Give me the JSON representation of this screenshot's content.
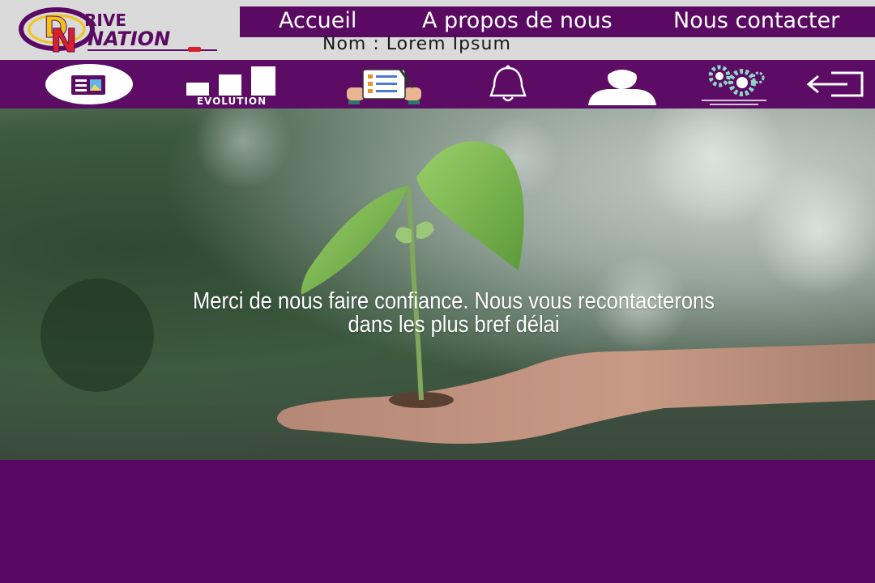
{
  "brand": {
    "logo_text_1": "RIVE",
    "logo_text_2": "NATION",
    "logo_letters": "DN"
  },
  "nav": {
    "items": [
      {
        "label": "Accueil"
      },
      {
        "label": "A propos de nous"
      },
      {
        "label": "Nous contacter"
      }
    ]
  },
  "user": {
    "name_line": "Nom : Lorem Ipsum"
  },
  "toolbar": {
    "items": [
      {
        "icon": "news-icon"
      },
      {
        "icon": "evolution-chart-icon",
        "label": "EVOLUTION"
      },
      {
        "icon": "form-checklist-icon"
      },
      {
        "icon": "bell-icon"
      },
      {
        "icon": "user-icon"
      },
      {
        "icon": "gears-icon"
      },
      {
        "icon": "logout-icon"
      }
    ]
  },
  "hero": {
    "line1": "Merci de nous faire confiance. Nous vous recontacterons",
    "line2": "dans les plus bref délai"
  },
  "colors": {
    "purple": "#5a0a62",
    "header_gray": "#dadada",
    "white": "#ffffff",
    "logo_yellow": "#f2c418",
    "logo_red": "#d8202a"
  }
}
